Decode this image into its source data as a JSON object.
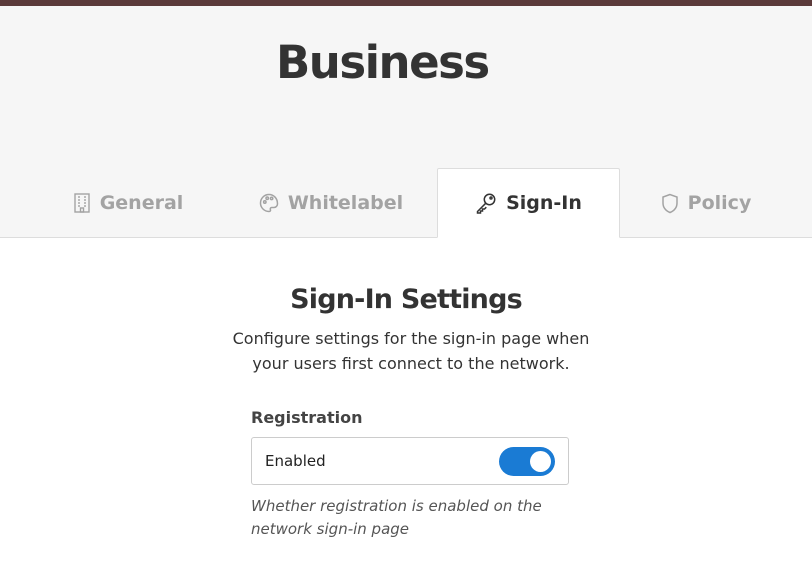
{
  "header": {
    "title": "Business"
  },
  "tabs": [
    {
      "label": "General",
      "icon": "building-icon",
      "active": false
    },
    {
      "label": "Whitelabel",
      "icon": "palette-icon",
      "active": false
    },
    {
      "label": "Sign-In",
      "icon": "key-icon",
      "active": true
    },
    {
      "label": "Policy",
      "icon": "shield-icon",
      "active": false
    }
  ],
  "main": {
    "title": "Sign-In Settings",
    "description": "Configure settings for the sign-in page when your users first connect to the network.",
    "registration": {
      "label": "Registration",
      "value_text": "Enabled",
      "enabled": true,
      "help": "Whether registration is enabled on the network sign-in page"
    }
  },
  "colors": {
    "topbar": "#5b3a3a",
    "toggle_on": "#1a7bd4",
    "tab_inactive": "#a3a3a3",
    "text_primary": "#333333"
  }
}
